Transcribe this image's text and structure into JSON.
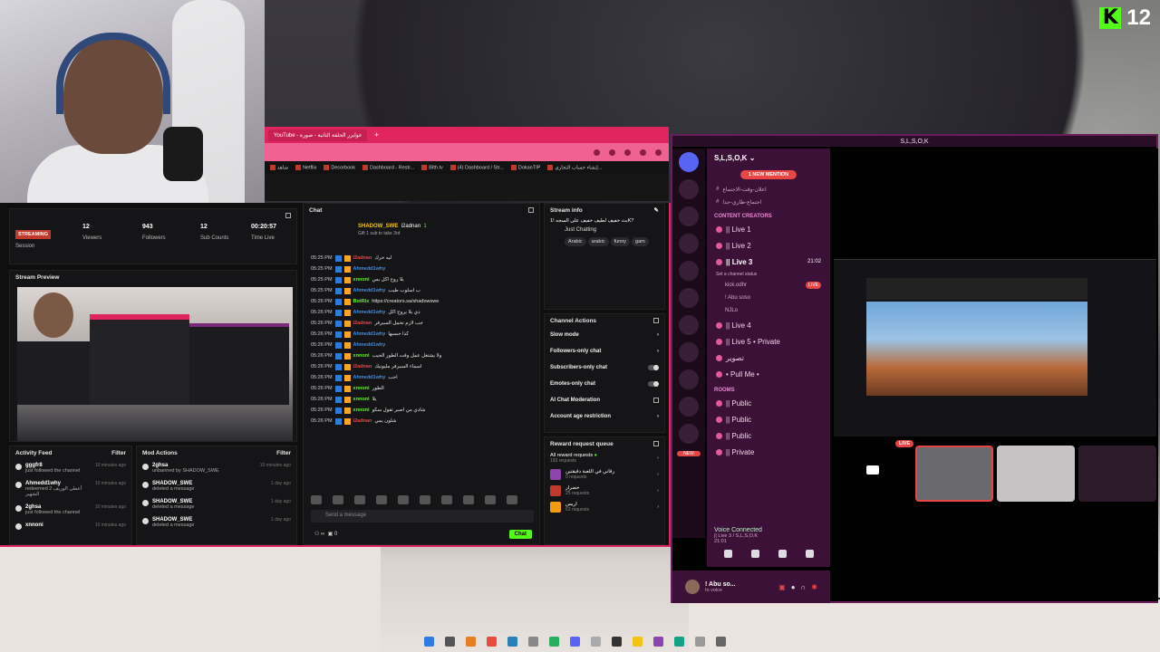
{
  "overlay": {
    "badge_letter": "K",
    "badge_number": "12"
  },
  "browser": {
    "tabs": [
      "YouTube - غوايزر الحلقة الثانية - صورة",
      "+"
    ],
    "bookmarks": [
      "شاهد",
      "Netflix",
      "Decorbook",
      "Dashboard - Restr...",
      "BIth.tv",
      "(4) Dashboard / Str...",
      "DokanTIP",
      "إنشاء حساب التجاري..."
    ]
  },
  "dashboard": {
    "session": {
      "badge": "STREAMING",
      "label": "Session"
    },
    "stats": [
      {
        "value": "12",
        "label": "Viewers"
      },
      {
        "value": "943",
        "label": "Followers"
      },
      {
        "value": "12",
        "label": "Sub Counts"
      },
      {
        "value": "00:20:57",
        "label": "Time Live"
      }
    ],
    "preview_title": "Stream Preview",
    "activity": {
      "title": "Activity Feed",
      "filter": "Filter",
      "items": [
        {
          "name": "gggfr8",
          "text": "just followed the channel",
          "time": "10 minutes ago"
        },
        {
          "name": "Ahmedd1why",
          "text": "redeemed أعطى الوريف 2 الشهير",
          "time": "10 minutes ago"
        },
        {
          "name": "2ghsa",
          "text": "just followed the channel",
          "time": "10 minutes ago"
        },
        {
          "name": "xnnoni",
          "text": "",
          "time": "10 minutes ago"
        }
      ]
    },
    "mod": {
      "title": "Mod Actions",
      "filter": "Filter",
      "items": [
        {
          "name": "2ghsa",
          "text": "unbanned by SHADOW_SWE",
          "time": "10 minutes ago"
        },
        {
          "name": "SHADOW_SWE",
          "text": "deleted a message",
          "time": "1 day ago"
        },
        {
          "name": "SHADOW_SWE",
          "text": "deleted a message",
          "time": "1 day ago"
        },
        {
          "name": "SHADOW_SWE",
          "text": "deleted a message",
          "time": "1 day ago"
        }
      ]
    },
    "chat": {
      "title": "Chat",
      "pinned_user": "SHADOW_SWE",
      "pinned_to": "i2adnan",
      "pinned_count": "1",
      "pinned_text": "Gift 1 sub to take 3rd",
      "lines": [
        {
          "time": "05:25 PM",
          "user": "i2adnan",
          "color": "#e84545",
          "msg": "ليه حرك"
        },
        {
          "time": "05:25 PM",
          "user": "Ahmedd1why",
          "color": "#3b8ee8",
          "msg": ""
        },
        {
          "time": "05:25 PM",
          "user": "xnnoni",
          "color": "#53fc18",
          "msg": "يلا روح اكل بس"
        },
        {
          "time": "05:25 PM",
          "user": "Ahmedd1why",
          "color": "#3b8ee8",
          "msg": "ب اسلوب طيب"
        },
        {
          "time": "05:26 PM",
          "user": "BotRix",
          "color": "#53fc18",
          "msg": "https://creators.sa/shadowswe"
        },
        {
          "time": "05:26 PM",
          "user": "Ahmedd1why",
          "color": "#3b8ee8",
          "msg": "ذي بلا يروح اكل"
        },
        {
          "time": "05:26 PM",
          "user": "i2adnan",
          "color": "#e84545",
          "msg": "جب لازم تحمل السيرفر"
        },
        {
          "time": "05:26 PM",
          "user": "Ahmedd1why",
          "color": "#3b8ee8",
          "msg": "كذا حسبها"
        },
        {
          "time": "05:26 PM",
          "user": "Ahmedd1why",
          "color": "#3b8ee8",
          "msg": ""
        },
        {
          "time": "05:26 PM",
          "user": "xnnoni",
          "color": "#53fc18",
          "msg": "ولا يشتغل عمل وقت الطور الحيب"
        },
        {
          "time": "05:26 PM",
          "user": "i2adnan",
          "color": "#e84545",
          "msg": "اسماء السيرفر مليونيك"
        },
        {
          "time": "05:26 PM",
          "user": "Ahmedd1why",
          "color": "#3b8ee8",
          "msg": "احب"
        },
        {
          "time": "05:26 PM",
          "user": "xnnoni",
          "color": "#53fc18",
          "msg": "الطور"
        },
        {
          "time": "05:26 PM",
          "user": "xnnoni",
          "color": "#53fc18",
          "msg": "يلا"
        },
        {
          "time": "05:26 PM",
          "user": "xnnoni",
          "color": "#53fc18",
          "msg": "شادي من اصبر تقول سكو"
        },
        {
          "time": "05:26 PM",
          "user": "i2adnan",
          "color": "#e84545",
          "msg": "شلون يمي"
        }
      ],
      "input_placeholder": "Send a message",
      "send_label": "Chat",
      "meta_count": "0"
    },
    "stream_info": {
      "title": "Stream info",
      "headline": "بث خفيف لطيف خفيف على السجه !1K?",
      "category": "Just Chatting",
      "tags": [
        "Arabic",
        "arabic",
        "funny",
        "gam"
      ]
    },
    "channel_actions": {
      "title": "Channel Actions",
      "rows": [
        "Slow mode",
        "Followers-only chat",
        "Subscribers-only chat",
        "Emotes-only chat",
        "AI Chat Moderation",
        "Account age restriction"
      ]
    },
    "rewards": {
      "title": "Reward request queue",
      "all": {
        "label": "All reward requests",
        "sub": "193 requests"
      },
      "items": [
        {
          "label": "رقاني في اللعبة دقيقتين",
          "sub": "0 requests",
          "color": "#8e44ad"
        },
        {
          "label": "حضرار",
          "sub": "25 requests",
          "color": "#c0392b"
        },
        {
          "label": "اريس",
          "sub": "63 requests",
          "color": "#f39c12"
        }
      ]
    }
  },
  "discord": {
    "window_title": "S,L,S,O,K",
    "server_name": "S,L,S,O,K",
    "mention": "1 NEW MENTION",
    "top_channels": [
      "اعلان-وقت-الاجتماع",
      "اجتماع-طاري-جدا"
    ],
    "category_creators": "CONTENT CREATORS",
    "channels": [
      "|| Live 1",
      "|| Live 2",
      "|| Live 3"
    ],
    "live3_time": "21:02",
    "live3_status": "Set a channel status",
    "live3_users": [
      "kick.odhr",
      "! Abu soso",
      "NJLo"
    ],
    "more_channels": [
      "|| Live 4",
      "|| Live 5 • Private",
      "تصوير",
      "• Pull Me •"
    ],
    "category_rooms": "ROOMS",
    "rooms": [
      "|| Public",
      "|| Public",
      "|| Public",
      "|| Private"
    ],
    "new_badge": "NEW",
    "voice": {
      "title": "Voice Connected",
      "sub": "|| Live 3 / S,L,S,O,K",
      "time": "21:01"
    },
    "user": {
      "name": "! Abu so...",
      "status": "In voice"
    },
    "live_badge": "LIVE",
    "tile_live": "LIVE"
  }
}
